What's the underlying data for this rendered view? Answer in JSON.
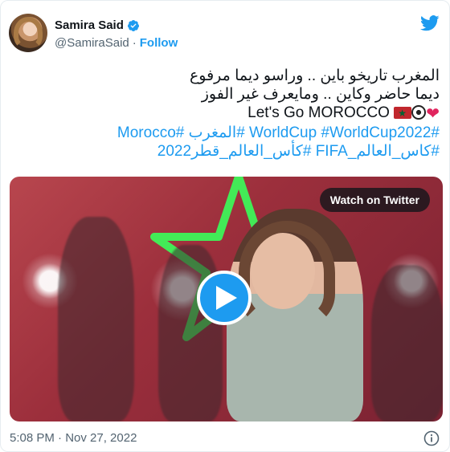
{
  "author": {
    "name": "Samira Said",
    "handle": "@SamiraSaid",
    "separator": "·",
    "follow_label": "Follow",
    "verified_icon": "verified-badge-icon"
  },
  "tweet": {
    "line1": "المغرب تاريخو باين .. وراسو ديما مرفوع",
    "line2": "ديما حاضر وكاين .. ومايعرف غير الفوز",
    "line3_text": "Let's Go MOROCCO",
    "line3_emojis": [
      "morocco-flag-emoji",
      "soccer-ball-emoji",
      "red-heart-emoji"
    ],
    "hashtags_line1": "#WorldCup #WorldCup2022 #المغرب #Morocco",
    "hashtags_line2": "#كاس_العالم_FIFA #كأس_العالم_قطر2022"
  },
  "media": {
    "watch_label": "Watch on Twitter",
    "play_icon": "play-icon"
  },
  "timestamp": "5:08 PM · Nov 27, 2022",
  "colors": {
    "accent": "#1d9bf0",
    "text": "#0f1419",
    "secondary_text": "#536471",
    "star_green": "#39ff5a"
  }
}
